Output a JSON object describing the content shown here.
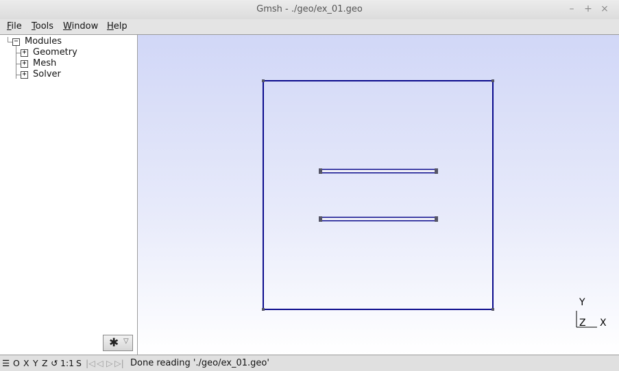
{
  "window": {
    "title": "Gmsh - ./geo/ex_01.geo",
    "minimize_glyph": "–",
    "maximize_glyph": "+",
    "close_glyph": "×"
  },
  "menu": {
    "file": {
      "u": "F",
      "rest": "ile"
    },
    "tools": {
      "u": "T",
      "rest": "ools"
    },
    "window": {
      "u": "W",
      "rest": "indow"
    },
    "help": {
      "u": "H",
      "rest": "elp"
    }
  },
  "tree": {
    "root": {
      "label": "Modules",
      "expander": "−"
    },
    "items": [
      {
        "label": "Geometry",
        "expander": "+"
      },
      {
        "label": "Mesh",
        "expander": "+"
      },
      {
        "label": "Solver",
        "expander": "+"
      }
    ]
  },
  "panel": {
    "gear_glyph": "✱",
    "dropdown_glyph": "▽"
  },
  "axes": {
    "y": "Y",
    "z": "Z",
    "x": "X"
  },
  "statusbar": {
    "menu_glyph": "☰",
    "o": "O",
    "x": "X",
    "y": "Y",
    "z": "Z",
    "rotate_glyph": "↺",
    "scale": "1:1",
    "s": "S",
    "first_glyph": "|◁",
    "prev_glyph": "◁",
    "play_glyph": "▷",
    "last_glyph": "▷|",
    "message": "Done reading './geo/ex_01.geo'"
  },
  "colors": {
    "geometry_line": "#0a0a8c",
    "point": "#555566",
    "background_top": "#d1d7f7",
    "background_bottom": "#ffffff"
  }
}
